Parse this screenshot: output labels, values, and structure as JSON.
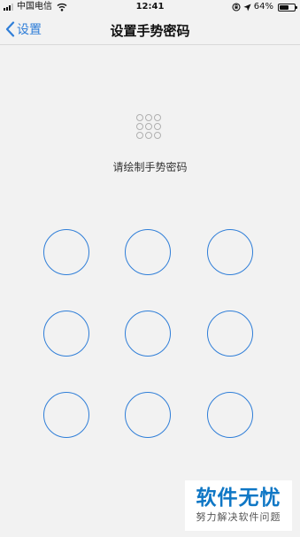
{
  "status_bar": {
    "carrier": "中国电信",
    "time": "12:41",
    "battery": "64%",
    "battery_level": 0.64,
    "icons": [
      "signal-icon",
      "wifi-icon",
      "rotation-lock-icon",
      "location-arrow-icon",
      "battery-icon"
    ]
  },
  "nav": {
    "back_label": "设置",
    "title": "设置手势密码"
  },
  "gesture": {
    "prompt": "请绘制手势密码",
    "node_count": 9,
    "accent_color": "#2f7ed8"
  },
  "watermark": {
    "logo": "软件无忧",
    "tagline": "努力解决软件问题"
  }
}
